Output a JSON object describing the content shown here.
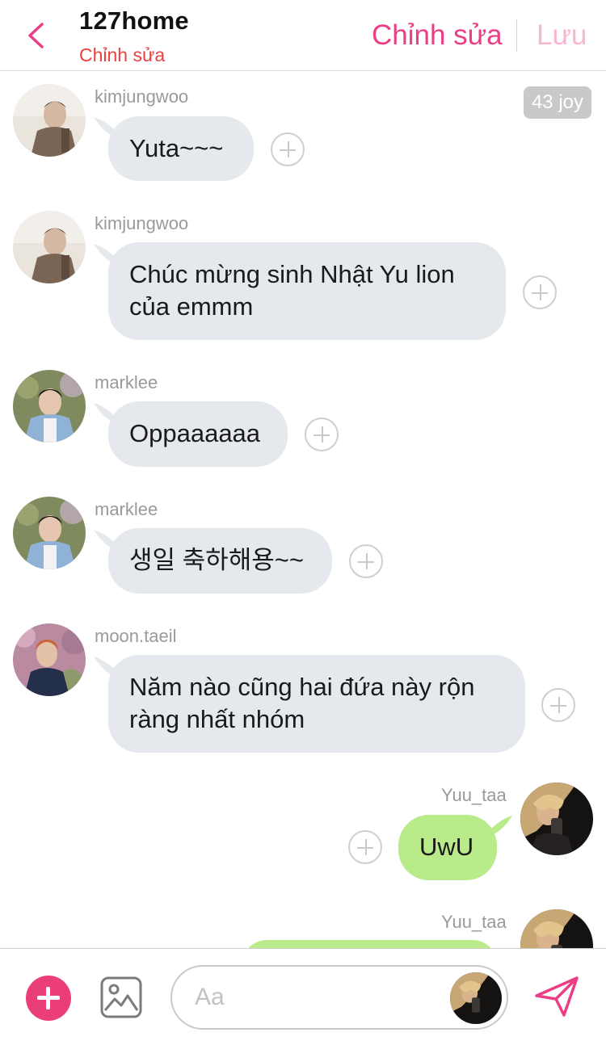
{
  "header": {
    "title": "127home",
    "subtitle": "Chỉnh sửa",
    "edit_label": "Chỉnh sửa",
    "save_label": "Lưu"
  },
  "badge": "43 joy",
  "messages": [
    {
      "sender": "kimjungwoo",
      "text": "Yuta~~~",
      "direction": "incoming"
    },
    {
      "sender": "kimjungwoo",
      "text_line1": "Chúc mừng sinh Nhật Yu lion",
      "text_line2": "của emmm",
      "direction": "incoming"
    },
    {
      "sender": "marklee",
      "text": "Oppaaaaaa",
      "direction": "incoming"
    },
    {
      "sender": "marklee",
      "text": "생일 축하해용~~",
      "direction": "incoming"
    },
    {
      "sender": "moon.taeil",
      "text_line1": "Năm nào cũng hai đứa này rộn",
      "text_line2": "ràng nhất nhóm",
      "direction": "incoming"
    },
    {
      "sender": "Yuu_taa",
      "text": "UwU",
      "direction": "outgoing"
    },
    {
      "sender": "Yuu_taa",
      "text": "",
      "direction": "outgoing"
    }
  ],
  "composer": {
    "placeholder": "Aa"
  },
  "colors": {
    "accent": "#ec3d87",
    "incoming_bubble": "#e5e8ec",
    "outgoing_bubble": "#b9eb8a"
  }
}
